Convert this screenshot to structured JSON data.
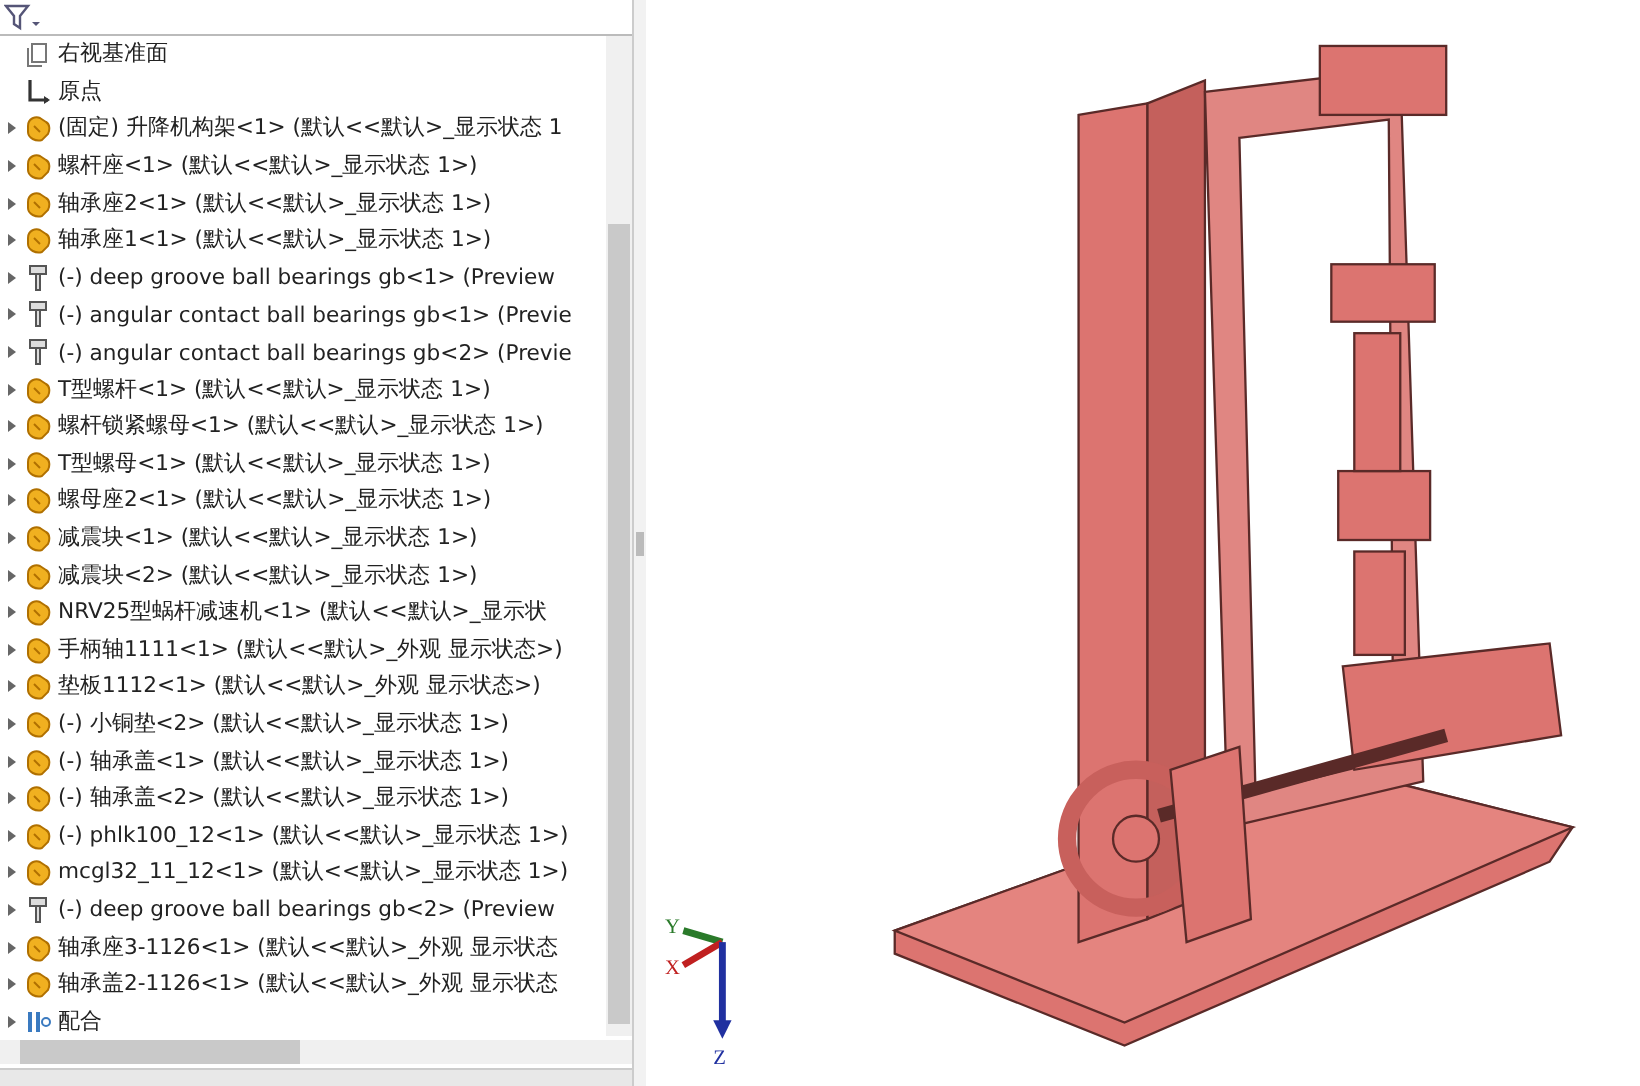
{
  "tree": {
    "items": [
      {
        "kind": "plane",
        "label": "右视基准面"
      },
      {
        "kind": "origin",
        "label": "原点"
      },
      {
        "kind": "part",
        "label": "(固定) 升降机构架<1> (默认<<默认>_显示状态 1"
      },
      {
        "kind": "part",
        "label": "螺杆座<1> (默认<<默认>_显示状态 1>)"
      },
      {
        "kind": "part",
        "label": "轴承座2<1> (默认<<默认>_显示状态 1>)"
      },
      {
        "kind": "part",
        "label": "轴承座1<1> (默认<<默认>_显示状态 1>)"
      },
      {
        "kind": "toolbox",
        "label": "(-) deep groove ball bearings gb<1> (Preview"
      },
      {
        "kind": "toolbox",
        "label": "(-) angular contact ball bearings gb<1> (Previe"
      },
      {
        "kind": "toolbox",
        "label": "(-) angular contact ball bearings gb<2> (Previe"
      },
      {
        "kind": "part",
        "label": "T型螺杆<1> (默认<<默认>_显示状态 1>)"
      },
      {
        "kind": "part",
        "label": "螺杆锁紧螺母<1> (默认<<默认>_显示状态 1>)"
      },
      {
        "kind": "part",
        "label": "T型螺母<1> (默认<<默认>_显示状态 1>)"
      },
      {
        "kind": "part",
        "label": "螺母座2<1> (默认<<默认>_显示状态 1>)"
      },
      {
        "kind": "part",
        "label": "减震块<1> (默认<<默认>_显示状态 1>)"
      },
      {
        "kind": "part",
        "label": "减震块<2> (默认<<默认>_显示状态 1>)"
      },
      {
        "kind": "part",
        "label": "NRV25型蜗杆减速机<1> (默认<<默认>_显示状"
      },
      {
        "kind": "part",
        "label": "手柄轴1111<1> (默认<<默认>_外观 显示状态>)"
      },
      {
        "kind": "part",
        "label": "垫板1112<1> (默认<<默认>_外观 显示状态>)"
      },
      {
        "kind": "part",
        "label": "(-) 小铜垫<2> (默认<<默认>_显示状态 1>)"
      },
      {
        "kind": "part",
        "label": "(-) 轴承盖<1> (默认<<默认>_显示状态 1>)"
      },
      {
        "kind": "part",
        "label": "(-) 轴承盖<2> (默认<<默认>_显示状态 1>)"
      },
      {
        "kind": "part",
        "label": "(-) phlk100_12<1> (默认<<默认>_显示状态 1>)"
      },
      {
        "kind": "part",
        "label": "mcgl32_11_12<1> (默认<<默认>_显示状态 1>)"
      },
      {
        "kind": "toolbox",
        "label": "(-) deep groove ball bearings gb<2> (Preview"
      },
      {
        "kind": "part",
        "label": "轴承座3-1126<1> (默认<<默认>_外观 显示状态"
      },
      {
        "kind": "part",
        "label": "轴承盖2-1126<1> (默认<<默认>_外观 显示状态"
      },
      {
        "kind": "mates",
        "label": "配合"
      }
    ]
  },
  "triad": {
    "x": "X",
    "y": "Y",
    "z": "Z"
  }
}
